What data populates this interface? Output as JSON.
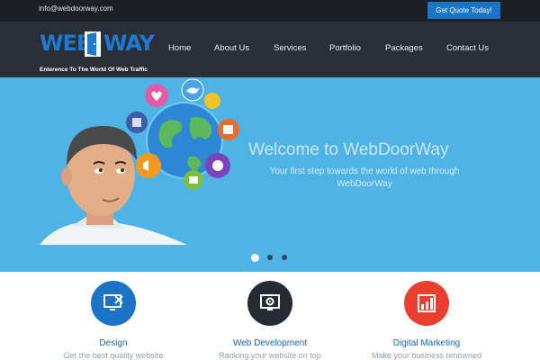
{
  "topbar": {
    "email": "info@webdoorway.com",
    "quote_button": "Get Quote Today!"
  },
  "logo": {
    "word_left": "WEB",
    "word_right": "WAY",
    "tagline": "Enterence To The World Of Web Traffic"
  },
  "nav": {
    "items": [
      "Home",
      "About Us",
      "Services",
      "Portfolio",
      "Packages",
      "Contact Us"
    ]
  },
  "hero": {
    "title": "Welcome to WebDoorWay",
    "subtitle": "Your first step towards the world of web through WebDoorWay",
    "slide_active": 1,
    "slide_count": 3
  },
  "services": [
    {
      "title": "Design",
      "desc": "Get the best quality website",
      "icon": "monitor-design-icon",
      "color": "#1a73c5"
    },
    {
      "title": "Web Development",
      "desc": "Ranking your website on top",
      "icon": "monitor-gear-icon",
      "color": "#262a33"
    },
    {
      "title": "Digital Marketing",
      "desc": "Make your business renowned",
      "icon": "bar-chart-icon",
      "color": "#e8402e"
    }
  ],
  "colors": {
    "accent": "#1a74c8",
    "hero_bg": "#4fb3e6",
    "header_bg": "#2a2e37",
    "topbar_bg": "#1c1f26"
  }
}
